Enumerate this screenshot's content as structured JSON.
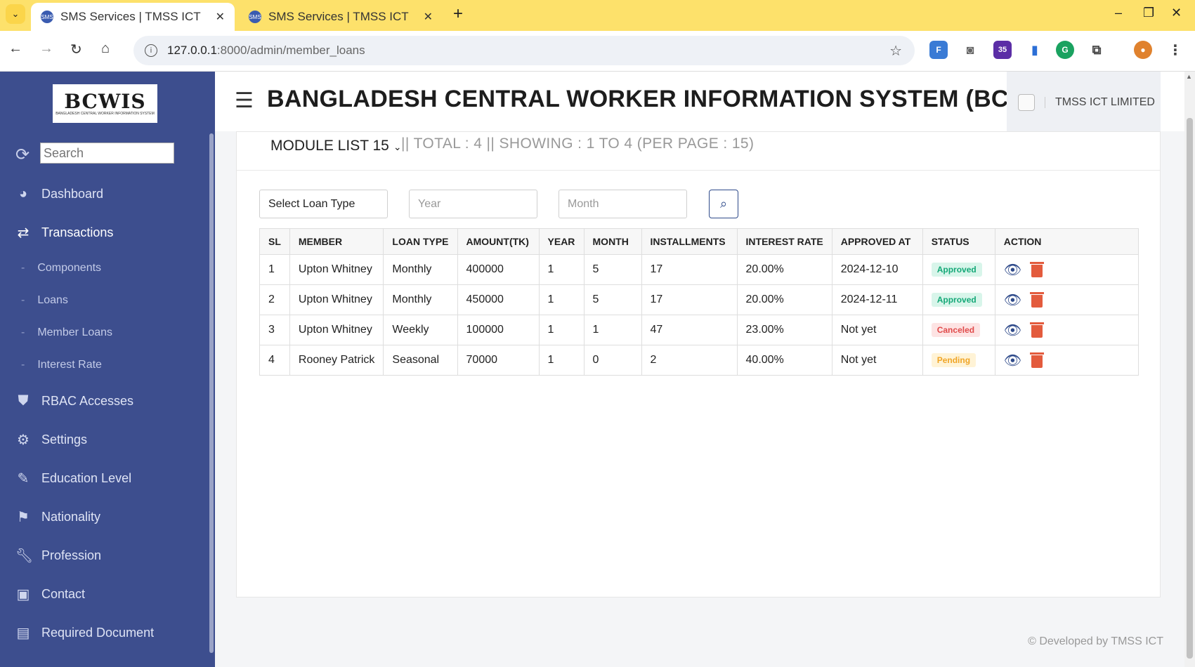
{
  "browser": {
    "tabs": [
      {
        "title": "SMS Services | TMSS ICT",
        "active": true
      },
      {
        "title": "SMS Services | TMSS ICT",
        "active": false
      }
    ],
    "url_host": "127.0.0.1",
    "url_path": ":8000/admin/member_loans",
    "extension_badge": "35"
  },
  "sidebar": {
    "logo_text": "BCWIS",
    "logo_subtext": "BANGLADESH CENTRAL WORKER INFORMATION SYSTEM",
    "search_placeholder": "Search",
    "items": [
      {
        "label": "Dashboard",
        "icon": "dashboard-icon"
      },
      {
        "label": "Transactions",
        "icon": "exchange-icon"
      },
      {
        "label": "Components"
      },
      {
        "label": "Loans"
      },
      {
        "label": "Member Loans"
      },
      {
        "label": "Interest Rate"
      },
      {
        "label": "RBAC Accesses",
        "icon": "shield-icon"
      },
      {
        "label": "Settings",
        "icon": "gear-icon"
      },
      {
        "label": "Education Level",
        "icon": "pencil-icon"
      },
      {
        "label": "Nationality",
        "icon": "flag-icon"
      },
      {
        "label": "Profession",
        "icon": "wrench-icon"
      },
      {
        "label": "Contact",
        "icon": "contact-card-icon"
      },
      {
        "label": "Required Document",
        "icon": "document-icon"
      }
    ]
  },
  "header": {
    "title": "BANGLADESH CENTRAL WORKER INFORMATION SYSTEM (BCWIS)",
    "company": "TMSS ICT LIMITED"
  },
  "card": {
    "module_select": "MODULE LIST 15",
    "totals": "|| TOTAL : 4 || SHOWING : 1 TO 4 (PER PAGE : 15)"
  },
  "filters": {
    "loan_type": "Select Loan Type",
    "year_placeholder": "Year",
    "month_placeholder": "Month"
  },
  "table": {
    "headers": [
      "SL",
      "MEMBER",
      "LOAN TYPE",
      "AMOUNT(TK)",
      "YEAR",
      "MONTH",
      "INSTALLMENTS",
      "INTEREST RATE",
      "APPROVED AT",
      "STATUS",
      "ACTION"
    ],
    "rows": [
      {
        "sl": "1",
        "member": "Upton Whitney",
        "loan_type": "Monthly",
        "amount": "400000",
        "year": "1",
        "month": "5",
        "installments": "17",
        "interest_rate": "20.00%",
        "approved_at": "2024-12-10",
        "status": "Approved"
      },
      {
        "sl": "2",
        "member": "Upton Whitney",
        "loan_type": "Monthly",
        "amount": "450000",
        "year": "1",
        "month": "5",
        "installments": "17",
        "interest_rate": "20.00%",
        "approved_at": "2024-12-11",
        "status": "Approved"
      },
      {
        "sl": "3",
        "member": "Upton Whitney",
        "loan_type": "Weekly",
        "amount": "100000",
        "year": "1",
        "month": "1",
        "installments": "47",
        "interest_rate": "23.00%",
        "approved_at": "Not yet",
        "status": "Canceled"
      },
      {
        "sl": "4",
        "member": "Rooney Patrick",
        "loan_type": "Seasonal",
        "amount": "70000",
        "year": "1",
        "month": "0",
        "installments": "2",
        "interest_rate": "40.00%",
        "approved_at": "Not yet",
        "status": "Pending"
      }
    ]
  },
  "footer": {
    "text": "© Developed by TMSS ICT"
  },
  "colors": {
    "sidebar_bg": "#3d4e8e",
    "tabbar_bg": "#fde16b",
    "approved": "#14a877",
    "canceled": "#e04a4a",
    "pending": "#f0a526"
  }
}
